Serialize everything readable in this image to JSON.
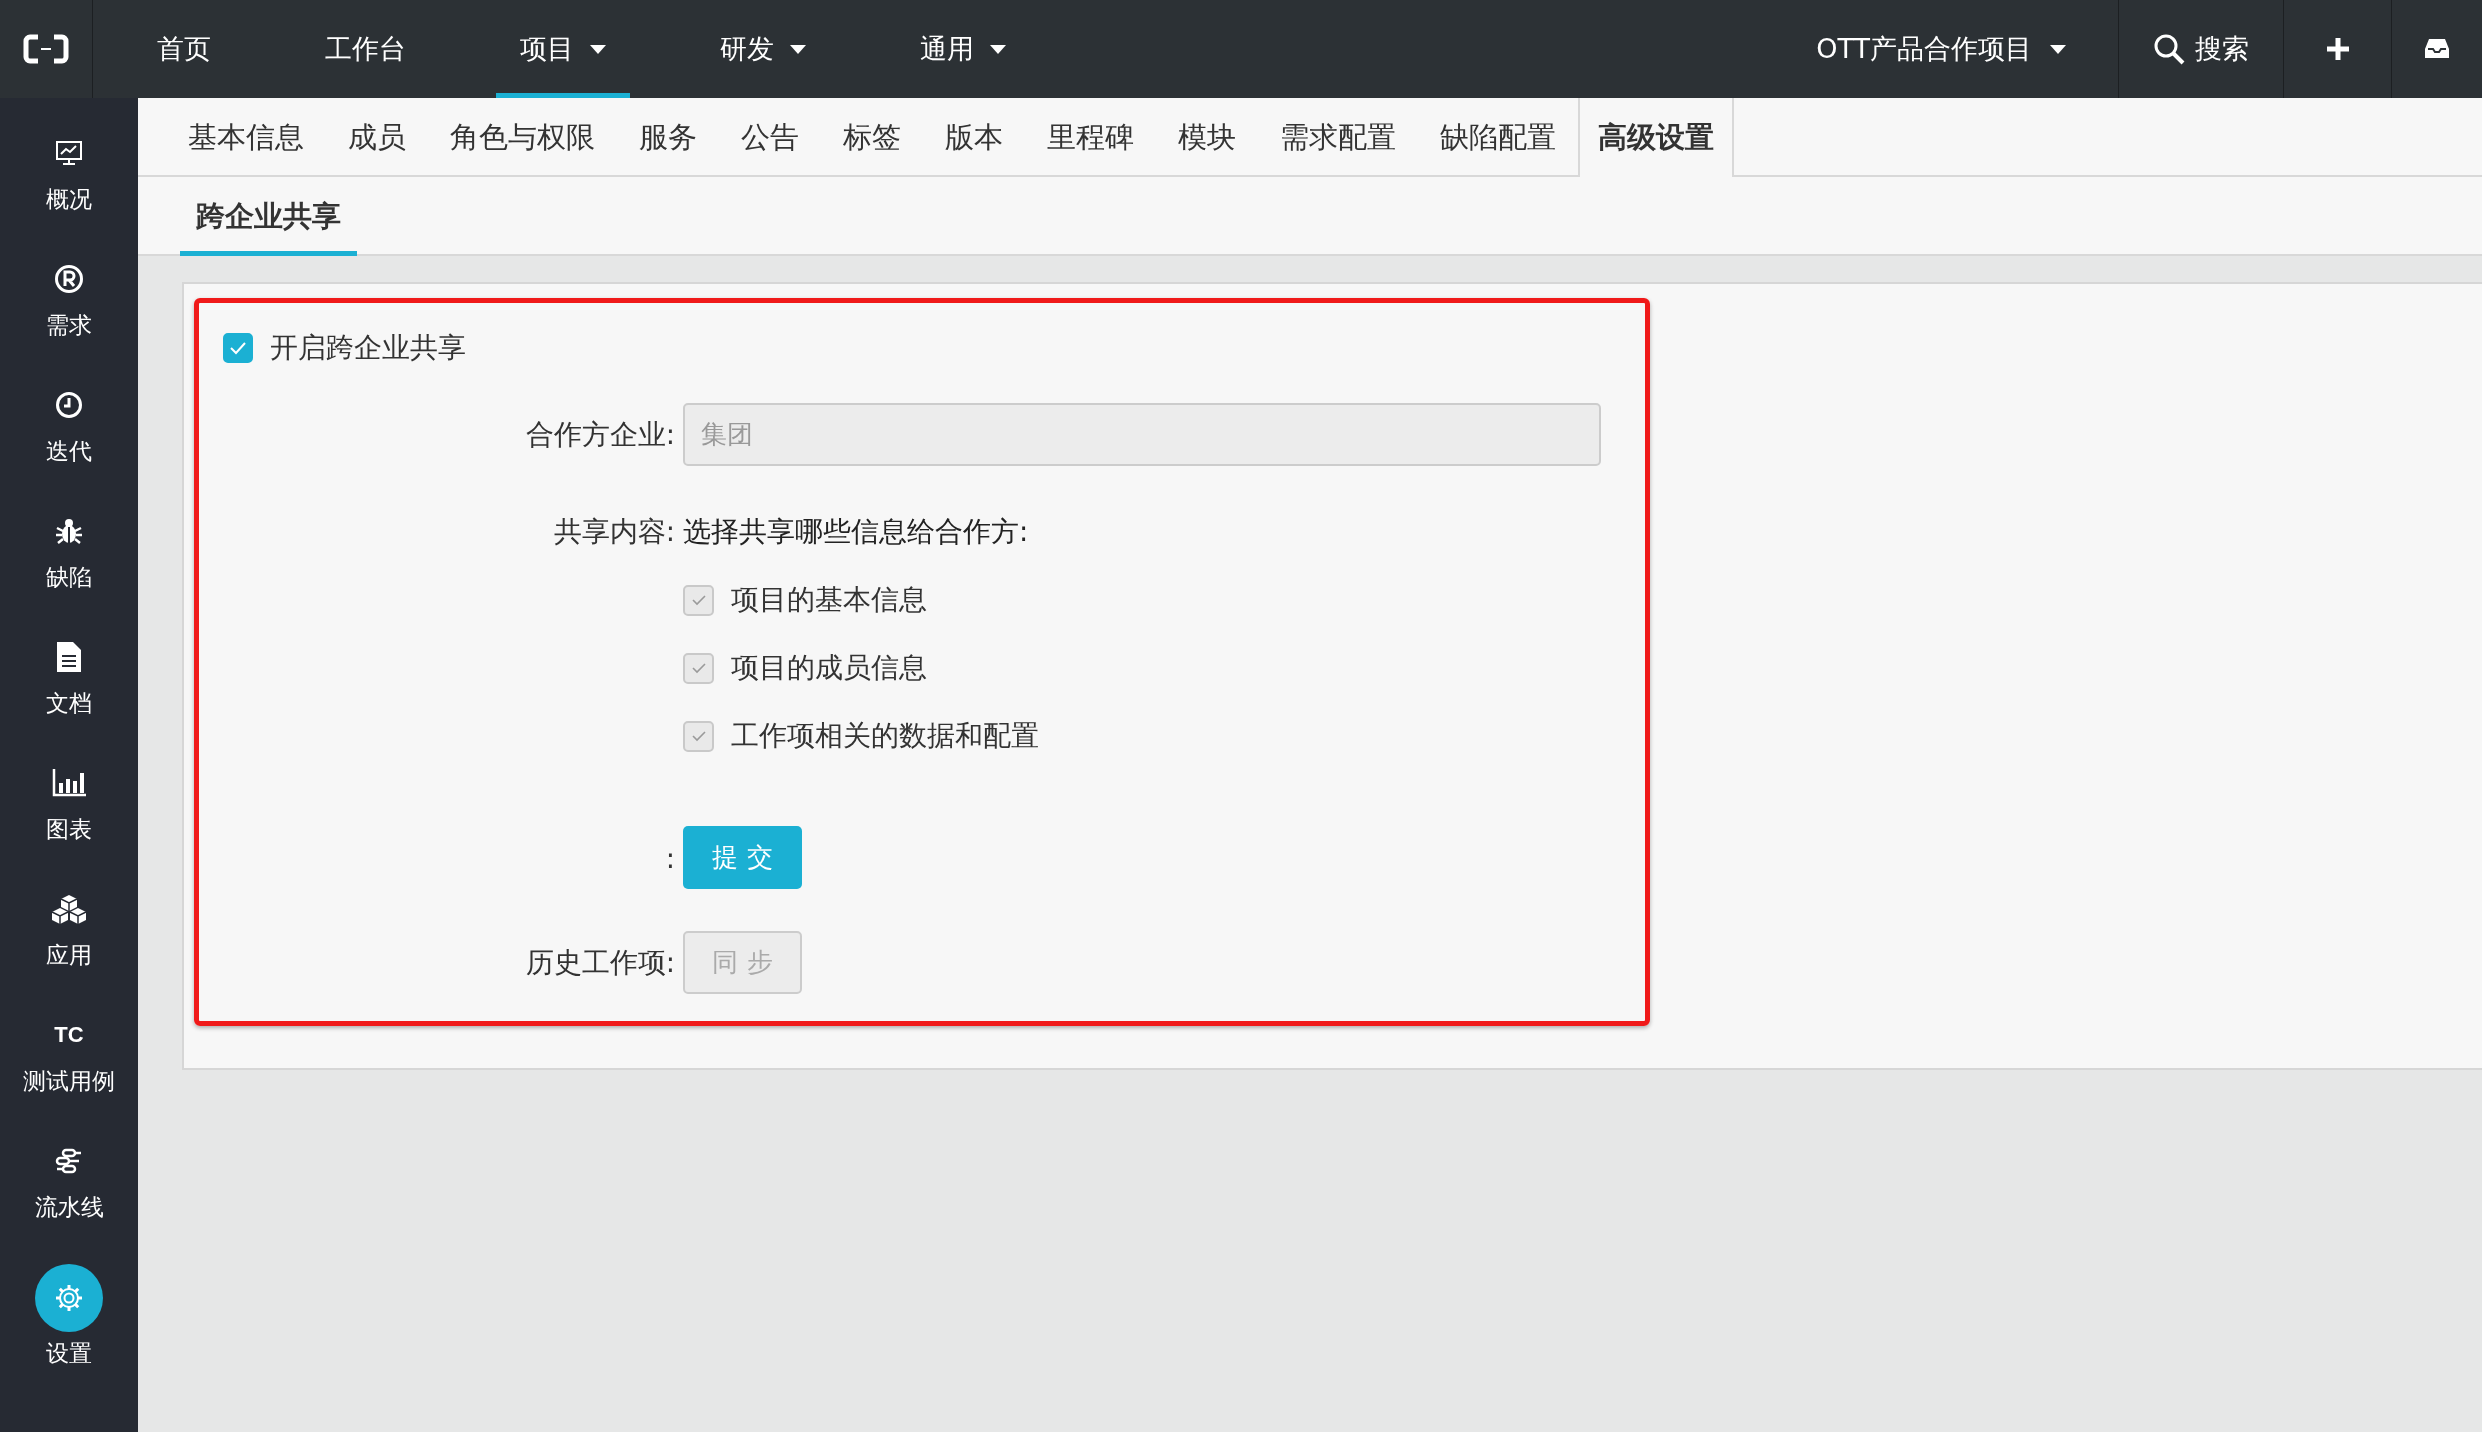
{
  "top_nav": {
    "items": [
      {
        "label": "首页",
        "dropdown": false,
        "selected": false
      },
      {
        "label": "工作台",
        "dropdown": false,
        "selected": false
      },
      {
        "label": "项目",
        "dropdown": true,
        "selected": true
      },
      {
        "label": "研发",
        "dropdown": true,
        "selected": false
      },
      {
        "label": "通用",
        "dropdown": true,
        "selected": false
      }
    ],
    "project_switcher": {
      "label": "OTT产品合作项目"
    },
    "search": {
      "label": "搜索"
    }
  },
  "sidebar": {
    "items": [
      {
        "kind": "monitor",
        "label": "概况",
        "selected": false
      },
      {
        "kind": "registered",
        "label": "需求",
        "selected": false
      },
      {
        "kind": "clock",
        "label": "迭代",
        "selected": false
      },
      {
        "kind": "bug",
        "label": "缺陷",
        "selected": false
      },
      {
        "kind": "document",
        "label": "文档",
        "selected": false
      },
      {
        "kind": "chart",
        "label": "图表",
        "selected": false
      },
      {
        "kind": "cubes",
        "label": "应用",
        "selected": false
      },
      {
        "kind": "text",
        "icon_text": "TC",
        "label": "测试用例",
        "selected": false
      },
      {
        "kind": "pipeline",
        "label": "流水线",
        "selected": false
      },
      {
        "kind": "gear",
        "label": "设置",
        "selected": true
      }
    ]
  },
  "settings_tabs": [
    {
      "label": "基本信息",
      "selected": false
    },
    {
      "label": "成员",
      "selected": false
    },
    {
      "label": "角色与权限",
      "selected": false
    },
    {
      "label": "服务",
      "selected": false
    },
    {
      "label": "公告",
      "selected": false
    },
    {
      "label": "标签",
      "selected": false
    },
    {
      "label": "版本",
      "selected": false
    },
    {
      "label": "里程碑",
      "selected": false
    },
    {
      "label": "模块",
      "selected": false
    },
    {
      "label": "需求配置",
      "selected": false
    },
    {
      "label": "缺陷配置",
      "selected": false
    },
    {
      "label": "高级设置",
      "selected": true
    }
  ],
  "sub_tabs": [
    {
      "label": "跨企业共享",
      "selected": true
    }
  ],
  "form": {
    "enable": {
      "label": "开启跨企业共享",
      "checked": true
    },
    "partner": {
      "label": "合作方企业:",
      "value": "集团",
      "disabled": true
    },
    "share": {
      "label": "共享内容:",
      "prompt": "选择共享哪些信息给合作方:",
      "options": [
        {
          "label": "项目的基本信息",
          "checked": true,
          "disabled": true
        },
        {
          "label": "项目的成员信息",
          "checked": true,
          "disabled": true
        },
        {
          "label": "工作项相关的数据和配置",
          "checked": true,
          "disabled": true
        }
      ]
    },
    "submit": {
      "label": ":",
      "button": "提 交",
      "disabled": false
    },
    "history": {
      "label": "历史工作项:",
      "button": "同 步",
      "disabled": true
    }
  }
}
